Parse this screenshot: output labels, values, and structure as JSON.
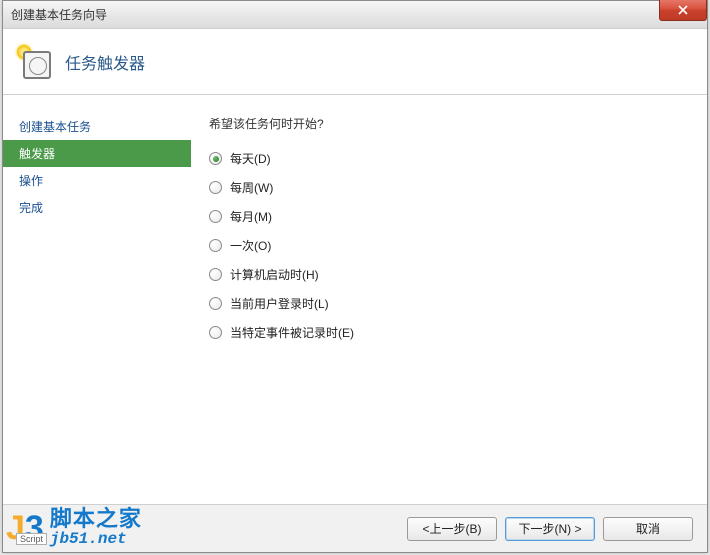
{
  "window": {
    "title": "创建基本任务向导"
  },
  "header": {
    "title": "任务触发器"
  },
  "sidebar": {
    "items": [
      {
        "label": "创建基本任务",
        "selected": false
      },
      {
        "label": "触发器",
        "selected": true
      },
      {
        "label": "操作",
        "selected": false
      },
      {
        "label": "完成",
        "selected": false
      }
    ]
  },
  "content": {
    "question": "希望该任务何时开始?",
    "options": [
      {
        "label": "每天(D)",
        "checked": true
      },
      {
        "label": "每周(W)",
        "checked": false
      },
      {
        "label": "每月(M)",
        "checked": false
      },
      {
        "label": "一次(O)",
        "checked": false
      },
      {
        "label": "计算机启动时(H)",
        "checked": false
      },
      {
        "label": "当前用户登录时(L)",
        "checked": false
      },
      {
        "label": "当特定事件被记录时(E)",
        "checked": false
      }
    ]
  },
  "footer": {
    "back": "<上一步(B)",
    "next": "下一步(N) >",
    "cancel": "取消"
  },
  "watermark": {
    "logo_j": "J",
    "logo_3": "3",
    "cn": "脚本之家",
    "url": "jb51.net",
    "script": "Script"
  }
}
